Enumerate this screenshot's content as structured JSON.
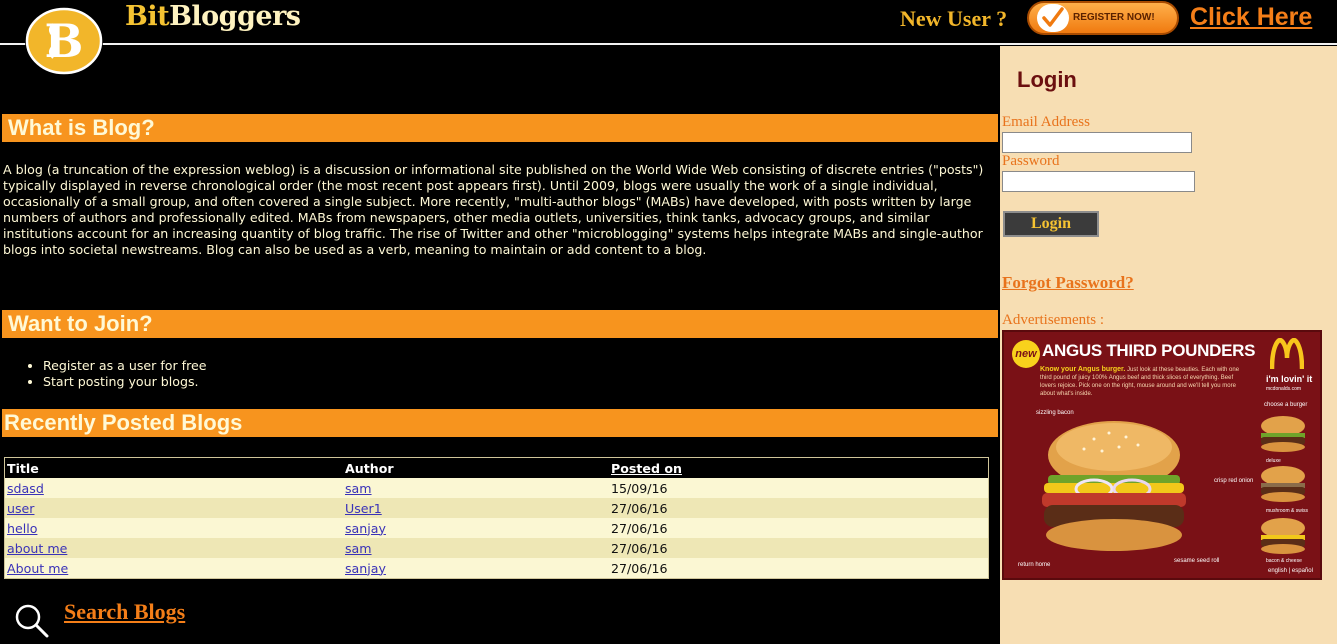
{
  "header": {
    "brand_bit": "Bit",
    "brand_bloggers": "Bloggers",
    "new_user": "New User ?",
    "register_label": "REGISTER NOW!",
    "click_here": "Click Here",
    "accent_color": "#f7941e"
  },
  "sections": {
    "what_is_blog": "What is Blog?",
    "what_is_blog_text": "A blog (a truncation of the expression weblog) is a discussion or informational site published on the World Wide Web consisting of discrete entries (\"posts\") typically displayed in reverse chronological order (the most recent post appears first). Until 2009, blogs were usually the work of a single individual, occasionally of a small group, and often covered a single subject. More recently, \"multi-author blogs\" (MABs) have developed, with posts written by large numbers of authors and professionally edited. MABs from newspapers, other media outlets, universities, think tanks, advocacy groups, and similar institutions account for an increasing quantity of blog traffic. The rise of Twitter and other \"microblogging\" systems helps integrate MABs and single-author blogs into societal newstreams. Blog can also be used as a verb, meaning to maintain or add content to a blog.",
    "want_to_join": "Want to Join?",
    "join_items": [
      "Register as a user for free",
      "Start posting your blogs."
    ],
    "recent": "Recently Posted Blogs"
  },
  "blogs_table": {
    "headers": [
      "Title",
      "Author",
      "Posted on"
    ],
    "rows": [
      {
        "title": "sdasd",
        "author": "sam",
        "posted": "15/09/16"
      },
      {
        "title": "user",
        "author": "User1",
        "posted": "27/06/16"
      },
      {
        "title": "hello",
        "author": "sanjay",
        "posted": "27/06/16"
      },
      {
        "title": "about me",
        "author": "sam",
        "posted": "27/06/16"
      },
      {
        "title": "About me",
        "author": "sanjay",
        "posted": "27/06/16"
      }
    ]
  },
  "search": {
    "label": "Search Blogs",
    "icon": "search-icon"
  },
  "sidebar": {
    "login_title": "Login",
    "email_label": "Email Address",
    "email_value": "",
    "password_label": "Password",
    "password_value": "",
    "login_button": "Login",
    "forgot": "Forgot Password?",
    "ads_label": "Advertisements :"
  },
  "ad": {
    "new_badge": "new",
    "headline": "ANGUS THIRD POUNDERS",
    "sub_bold": "Know your Angus burger.",
    "sub_text": "Just look at these beauties. Each with one third pound of juicy 100% Angus beef and thick slices of everything. Beef lovers rejoice. Pick one on the right, mouse around and we'll tell you more about what's inside.",
    "slogan": "i'm lovin' it",
    "site": "mcdonalds.com",
    "choose": "choose a burger",
    "tag_bacon": "sizzling bacon",
    "tag_onion": "crisp red onion",
    "tag_roll": "sesame seed roll",
    "tag_home": "return home",
    "mini_deluxe": "deluxe",
    "mini_mushroom": "mushroom & swiss",
    "mini_bacon": "bacon & cheese",
    "lang": "english | español"
  }
}
